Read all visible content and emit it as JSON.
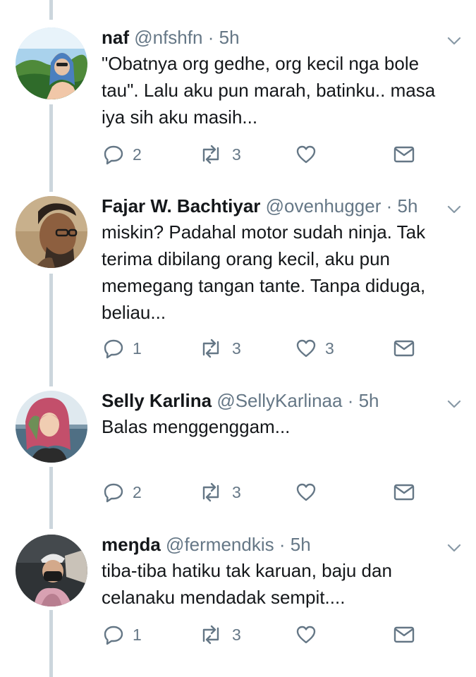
{
  "tweets": [
    {
      "name": "naf",
      "handle": "@nfshfn",
      "dot": "·",
      "time": "5h",
      "text": [
        "\"Obatnya org gedhe, org kecil nga bole",
        "tau\". Lalu aku pun marah, batinku.. masa",
        "iya sih aku masih..."
      ],
      "replies": "2",
      "retweets": "3",
      "likes": ""
    },
    {
      "name": "Fajar W. Bachtiyar",
      "handle": "@ovenhugger",
      "dot": "·",
      "time": "5h",
      "text": [
        "miskin? Padahal motor sudah ninja. Tak",
        "terima dibilang orang kecil, aku pun",
        "memegang tangan tante. Tanpa diduga,",
        "beliau..."
      ],
      "replies": "1",
      "retweets": "3",
      "likes": "3"
    },
    {
      "name": "Selly Karlina",
      "handle": "@SellyKarlinaa",
      "dot": "·",
      "time": "5h",
      "text": [
        "Balas menggenggam..."
      ],
      "replies": "2",
      "retweets": "3",
      "likes": ""
    },
    {
      "name": "meŋda",
      "handle": "@fermendkis",
      "dot": "·",
      "time": "5h",
      "text": [
        "tiba-tiba hatiku tak karuan, baju dan",
        "celanaku mendadak sempit...."
      ],
      "replies": "1",
      "retweets": "3",
      "likes": ""
    }
  ],
  "icons": {
    "reply": "reply-icon",
    "retweet": "retweet-icon",
    "like": "heart-icon",
    "dm": "envelope-icon",
    "caret": "chevron-down-icon"
  },
  "colors": {
    "thread_line": "#ccd6dd",
    "secondary_text": "#657786",
    "primary_text": "#14171a"
  }
}
